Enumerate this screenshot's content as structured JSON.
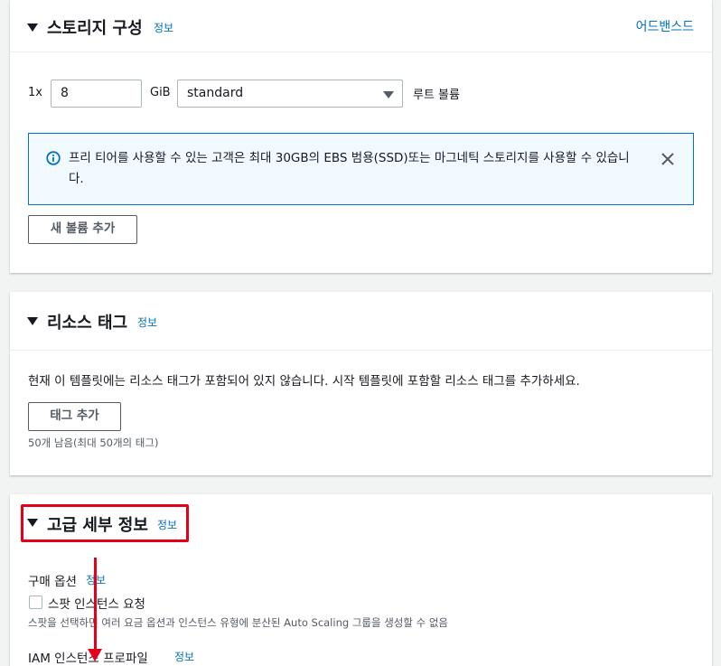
{
  "storage": {
    "title": "스토리지 구성",
    "info": "정보",
    "advanced": "어드밴스드",
    "count": "1x",
    "size_value": "8",
    "unit": "GiB",
    "volume_type": "standard",
    "root_label": "루트 볼륨",
    "alert_text": "프리 티어를 사용할 수 있는 고객은 최대 30GB의 EBS 범용(SSD)또는 마그네틱 스토리지를 사용할 수 있습니다.",
    "add_volume": "새 볼륨 추가"
  },
  "tags": {
    "title": "리소스 태그",
    "info": "정보",
    "empty_text": "현재 이 템플릿에는 리소스 태그가 포함되어 있지 않습니다. 시작 템플릿에 포함할 리소스 태그를 추가하세요.",
    "add_tag": "태그 추가",
    "remaining": "50개 남음(최대 50개의 태그)"
  },
  "advanced": {
    "title": "고급 세부 정보",
    "info": "정보",
    "purchase_label": "구매 옵션",
    "purchase_info": "정보",
    "spot_label": "스팟 인스턴스 요청",
    "spot_desc": "스팟을 선택하면 여러 요금 옵션과 인스턴스 유형에 분산된 Auto Scaling 그룹을 생성할 수 없음",
    "iam_label": "IAM 인스턴스 프로파일",
    "iam_info": "정보"
  },
  "colors": {
    "link": "#0073bb",
    "annotation": "#e4001b",
    "alert_bg": "#f1faff"
  },
  "icons": {
    "caret": "caret-down-icon",
    "info": "info-circle-icon",
    "close": "close-icon",
    "select": "chevron-down-icon"
  }
}
